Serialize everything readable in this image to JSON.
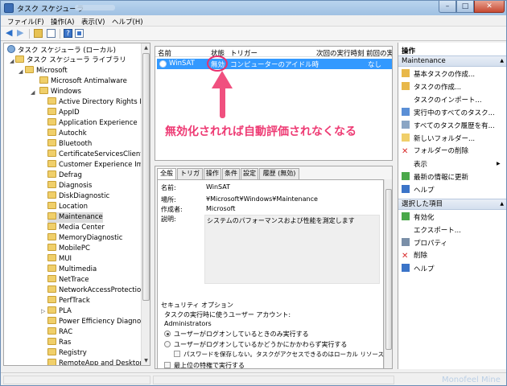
{
  "window": {
    "title": "タスク スケジューラ",
    "controls": {
      "minimize": "–",
      "maximize": "□",
      "close": "✕"
    }
  },
  "menu": [
    "ファイル(F)",
    "操作(A)",
    "表示(V)",
    "ヘルプ(H)"
  ],
  "toolbar": {
    "help_glyph": "?"
  },
  "tree": {
    "root": "タスク スケジューラ (ローカル)",
    "library": "タスク スケジューラ ライブラリ",
    "microsoft": "Microsoft",
    "antimalware": "Microsoft Antimalware",
    "windows": "Windows",
    "children": [
      "Active Directory Rights Mar",
      "AppID",
      "Application Experience",
      "Autochk",
      "Bluetooth",
      "CertificateServicesClient",
      "Customer Experience Impro",
      "Defrag",
      "Diagnosis",
      "DiskDiagnostic",
      "Location",
      "Maintenance",
      "Media Center",
      "MemoryDiagnostic",
      "MobilePC",
      "MUI",
      "Multimedia",
      "NetTrace",
      "NetworkAccessProtection",
      "PerfTrack",
      "PLA",
      "Power Efficiency Diagnostic",
      "RAC",
      "Ras",
      "Registry",
      "RemoteApp and Desktop C"
    ],
    "selected": "Maintenance"
  },
  "tasklist": {
    "columns": [
      "名前",
      "状態",
      "トリガー",
      "次回の実行時刻",
      "前回の実"
    ],
    "row": {
      "name": "WinSAT",
      "state": "無効",
      "trigger": "コンピューターのアイドル時",
      "last_run": "なし"
    }
  },
  "annotation": "無効化されれば自動評価されなくなる",
  "detail": {
    "tabs": [
      "全般",
      "トリガー",
      "操作",
      "条件",
      "設定",
      "履歴 (無効)"
    ],
    "name_label": "名前:",
    "name_value": "WinSAT",
    "location_label": "場所:",
    "location_value": "¥Microsoft¥Windows¥Maintenance",
    "author_label": "作成者:",
    "author_value": "Microsoft",
    "desc_label": "説明:",
    "desc_value": "システムのパフォーマンスおよび性能を測定します",
    "security_title": "セキュリティ オプション",
    "run_account_label": "タスクの実行時に使うユーザー アカウント:",
    "run_account_value": "Administrators",
    "radio_logged_on": "ユーザーがログオンしているときのみ実行する",
    "radio_any": "ユーザーがログオンしているかどうかにかかわらず実行する",
    "no_password": "パスワードを保存しない。タスクがアクセスできるのはローカル リソースのみ",
    "highest_priv": "最上位の特権で実行する"
  },
  "actions": {
    "title": "操作",
    "section1": "Maintenance",
    "items1": [
      "基本タスクの作成...",
      "タスクの作成...",
      "タスクのインポート...",
      "実行中のすべてのタスク...",
      "すべてのタスク履歴を有...",
      "新しいフォルダー...",
      "フォルダーの削除",
      "表示",
      "最新の情報に更新",
      "ヘルプ"
    ],
    "section2": "選択した項目",
    "items2": [
      "有効化",
      "エクスポート...",
      "プロパティ",
      "削除",
      "ヘルプ"
    ]
  },
  "watermark": "Monofeel Mine",
  "colors": {
    "accent": "#3399ff",
    "annotation": "#ee3b74"
  }
}
